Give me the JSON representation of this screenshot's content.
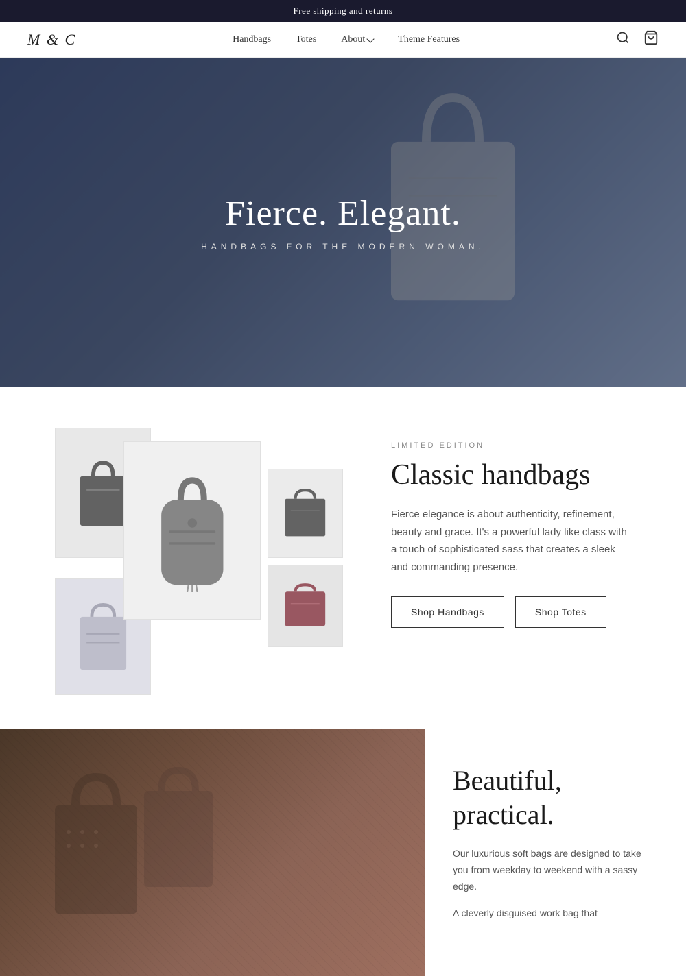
{
  "announcement": {
    "text": "Free shipping and returns"
  },
  "header": {
    "logo": "M & C",
    "nav": {
      "handbags": "Handbags",
      "totes": "Totes",
      "about": "About",
      "theme_features": "Theme Features"
    },
    "icons": {
      "search": "search-icon",
      "cart": "cart-icon"
    }
  },
  "hero": {
    "title": "Fierce. Elegant.",
    "subtitle": "HANDBAGS FOR THE MODERN WOMAN."
  },
  "feature_section": {
    "label": "LIMITED EDITION",
    "heading": "Classic handbags",
    "description": "Fierce elegance is about authenticity, refinement, beauty and grace. It's a powerful lady like class with a touch of sophisticated sass that creates a sleek and commanding presence.",
    "btn_handbags": "Shop Handbags",
    "btn_totes": "Shop Totes"
  },
  "second_section": {
    "heading": "Beautiful, practical.",
    "description": "Our luxurious soft bags are designed to take you from weekday to weekend with a sassy edge.",
    "extra_text": "A cleverly disguised work bag that"
  }
}
